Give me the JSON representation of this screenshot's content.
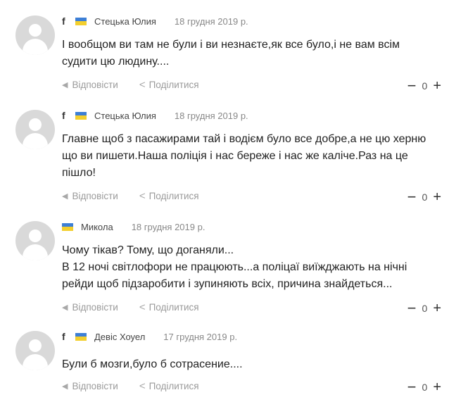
{
  "labels": {
    "reply": "Відповісти",
    "share": "Поділитися"
  },
  "comments": [
    {
      "author": "Стецька Юлия",
      "date": "18 грудня 2019 р.",
      "facebook": true,
      "lines": [
        "І вообщом ви там не були і ви незнаєте,як все було,і не вам всім",
        "судити цю людину...."
      ],
      "votes": "0"
    },
    {
      "author": "Стецька Юлия",
      "date": "18 грудня 2019 р.",
      "facebook": true,
      "lines": [
        "Главне щоб з пасажирами тай і водієм було все добре,а не цю херню",
        "що ви пишети.Наша поліція і нас береже і нас же каліче.Раз на це",
        "пішло!"
      ],
      "votes": "0"
    },
    {
      "author": "Микола",
      "date": "18 грудня 2019 р.",
      "facebook": false,
      "lines": [
        "Чому тікав? Тому, що доганяли...",
        "В 12 ночі світлофори не працюють...а поліцаї виїжджають на нічні",
        "рейди щоб підзаробити і зупиняють всіх, причина знайдеться..."
      ],
      "votes": "0"
    },
    {
      "author": "Девіс Хоуел",
      "date": "17 грудня 2019 р.",
      "facebook": true,
      "lines": [
        "Були б мозги,було б сотрасение...."
      ],
      "votes": "0"
    }
  ],
  "colors": {
    "flag_blue": "#3d7fd6",
    "flag_yellow": "#f3cf2e",
    "avatar": "#d9d9d9",
    "muted": "#9a9a9a"
  },
  "icons": {
    "facebook": "f",
    "reply": "reply-arrow-icon",
    "share": "share-icon",
    "minus": "−",
    "plus": "+"
  }
}
